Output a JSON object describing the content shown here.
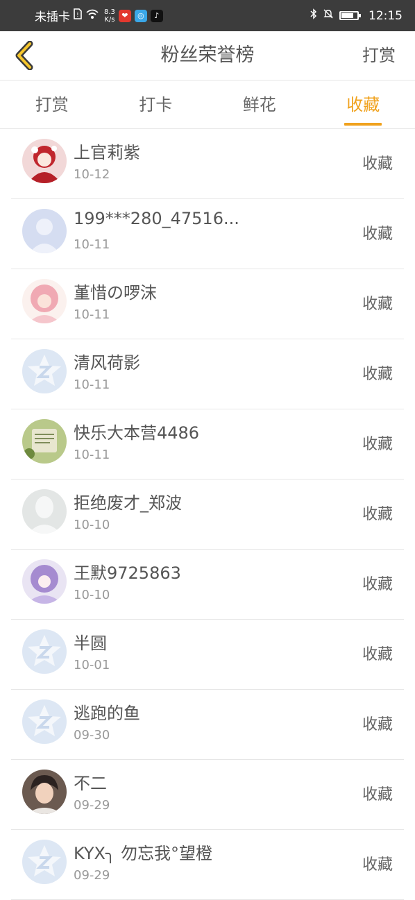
{
  "status_bar": {
    "carrier": "未插卡",
    "speed_value": "8.3",
    "speed_unit": "K/s",
    "time": "12:15",
    "icons": [
      "sim-icon",
      "wifi-icon",
      "weibo-icon",
      "app-icon",
      "tiktok-icon",
      "bluetooth-icon",
      "mute-icon",
      "battery-icon"
    ]
  },
  "header": {
    "title": "粉丝荣誉榜",
    "action": "打赏",
    "back_icon": "chevron-left-icon"
  },
  "tabs": [
    {
      "label": "打赏",
      "active": false
    },
    {
      "label": "打卡",
      "active": false
    },
    {
      "label": "鲜花",
      "active": false
    },
    {
      "label": "收藏",
      "active": true
    }
  ],
  "colors": {
    "accent": "#f0a21e",
    "status_bar": "#3c3c3c",
    "divider": "#e6e6e6",
    "text_primary": "#555555",
    "text_secondary": "#999999"
  },
  "list": [
    {
      "name": "上官莉紫",
      "date": "10-12",
      "action": "收藏",
      "avatar": "anime-red"
    },
    {
      "name": "199***280_47516...",
      "date": "10-11",
      "action": "收藏",
      "avatar": "default-person"
    },
    {
      "name": "堇惜の啰沫",
      "date": "10-11",
      "action": "收藏",
      "avatar": "anime-pink"
    },
    {
      "name": "清风荷影",
      "date": "10-11",
      "action": "收藏",
      "avatar": "default-star"
    },
    {
      "name": "快乐大本营4486",
      "date": "10-11",
      "action": "收藏",
      "avatar": "green-photo"
    },
    {
      "name": "拒绝废才_郑波",
      "date": "10-10",
      "action": "收藏",
      "avatar": "gray-person"
    },
    {
      "name": "王默9725863",
      "date": "10-10",
      "action": "收藏",
      "avatar": "anime-purple"
    },
    {
      "name": "半圆",
      "date": "10-01",
      "action": "收藏",
      "avatar": "default-star"
    },
    {
      "name": "逃跑的鱼",
      "date": "09-30",
      "action": "收藏",
      "avatar": "default-star"
    },
    {
      "name": "不二",
      "date": "09-29",
      "action": "收藏",
      "avatar": "photo-man"
    },
    {
      "name": "KYX╮ 勿忘我°望橙",
      "date": "09-29",
      "action": "收藏",
      "avatar": "default-star"
    }
  ]
}
